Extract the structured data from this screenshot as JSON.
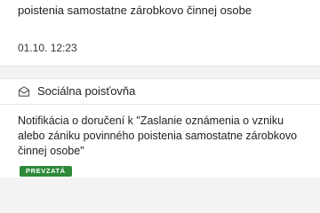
{
  "previous_notification": {
    "body_tail": "poistenia samostatne zárobkovo činnej osobe",
    "timestamp": "01.10. 12:23"
  },
  "notification": {
    "sender_icon": "envelope-icon",
    "sender": "Sociálna poisťovňa",
    "message": "Notifikácia o doručení k \"Zaslanie oznámenia o vzniku alebo zániku povinného poistenia samostatne zárobkovo činnej osobe\"",
    "status": "PREVZATÁ",
    "status_color": "#2e8a3a"
  }
}
